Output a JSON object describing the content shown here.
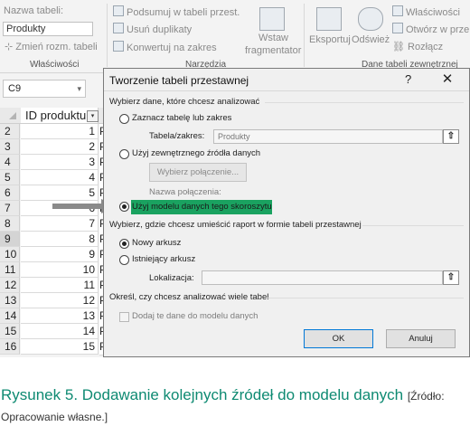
{
  "ribbon": {
    "table_name_label": "Nazwa tabeli:",
    "table_name_value": "Produkty",
    "resize_label": "Zmień rozm. tabeli",
    "group_properties": "Właściwości",
    "summarize_label": "Podsumuj w tabeli przest.",
    "remove_duplicates_label": "Usuń duplikaty",
    "convert_label": "Konwertuj na zakres",
    "group_tools": "Narzędzia",
    "slicer_label_1": "Wstaw",
    "slicer_label_2": "fragmentator",
    "export_label": "Eksportuj",
    "refresh_label": "Odśwież",
    "properties_label": "Właściwości",
    "open_browser_label": "Otwórz w prze",
    "unlink_label": "Rozłącz",
    "group_external": "Dane tabeli zewnętrznej"
  },
  "formula_bar": {
    "name_box": "C9"
  },
  "grid": {
    "column_header": "ID produktu",
    "rows": [
      {
        "num": "2",
        "id": "1",
        "next": "P"
      },
      {
        "num": "3",
        "id": "2",
        "next": "P"
      },
      {
        "num": "4",
        "id": "3",
        "next": "P"
      },
      {
        "num": "5",
        "id": "4",
        "next": "P"
      },
      {
        "num": "6",
        "id": "5",
        "next": "P"
      },
      {
        "num": "7",
        "id": "6",
        "next": "P"
      },
      {
        "num": "8",
        "id": "7",
        "next": "P"
      },
      {
        "num": "9",
        "id": "8",
        "next": "P"
      },
      {
        "num": "10",
        "id": "9",
        "next": "P"
      },
      {
        "num": "11",
        "id": "10",
        "next": "P"
      },
      {
        "num": "12",
        "id": "11",
        "next": "P"
      },
      {
        "num": "13",
        "id": "12",
        "next": "P"
      },
      {
        "num": "14",
        "id": "13",
        "next": "P"
      },
      {
        "num": "15",
        "id": "14",
        "next": "P"
      },
      {
        "num": "16",
        "id": "15",
        "next": "P"
      }
    ]
  },
  "dialog": {
    "title": "Tworzenie tabeli przestawnej",
    "help": "?",
    "close": "✕",
    "section_choose": "Wybierz dane, które chcesz analizować",
    "opt_table_range": "Zaznacz tabelę lub zakres",
    "table_range_label": "Tabela/zakres:",
    "table_range_value": "Produkty",
    "opt_external": "Użyj zewnętrznego źródła danych",
    "choose_connection_button": "Wybierz połączenie...",
    "connection_name_label": "Nazwa połączenia:",
    "opt_data_model": "Użyj modelu danych tego skoroszytu",
    "section_place": "Wybierz, gdzie chcesz umieścić raport w formie tabeli przestawnej",
    "opt_new_sheet": "Nowy arkusz",
    "opt_existing_sheet": "Istniejący arkusz",
    "location_label": "Lokalizacja:",
    "location_value": "",
    "section_multiple": "Określ, czy chcesz analizować wiele tabel",
    "add_to_model_label": "Dodaj te dane do modelu danych",
    "ok_button": "OK",
    "cancel_button": "Anuluj",
    "picker_glyph": "⇧"
  },
  "caption": {
    "title": "Rysunek 5. Dodawanie kolejnych źródeł do modelu danych",
    "source": "[Źródło: Opracowanie własne.]"
  },
  "colors": {
    "highlight": "#1aa260",
    "caption": "#0e8a72",
    "arrow": "#8a8a8a"
  }
}
